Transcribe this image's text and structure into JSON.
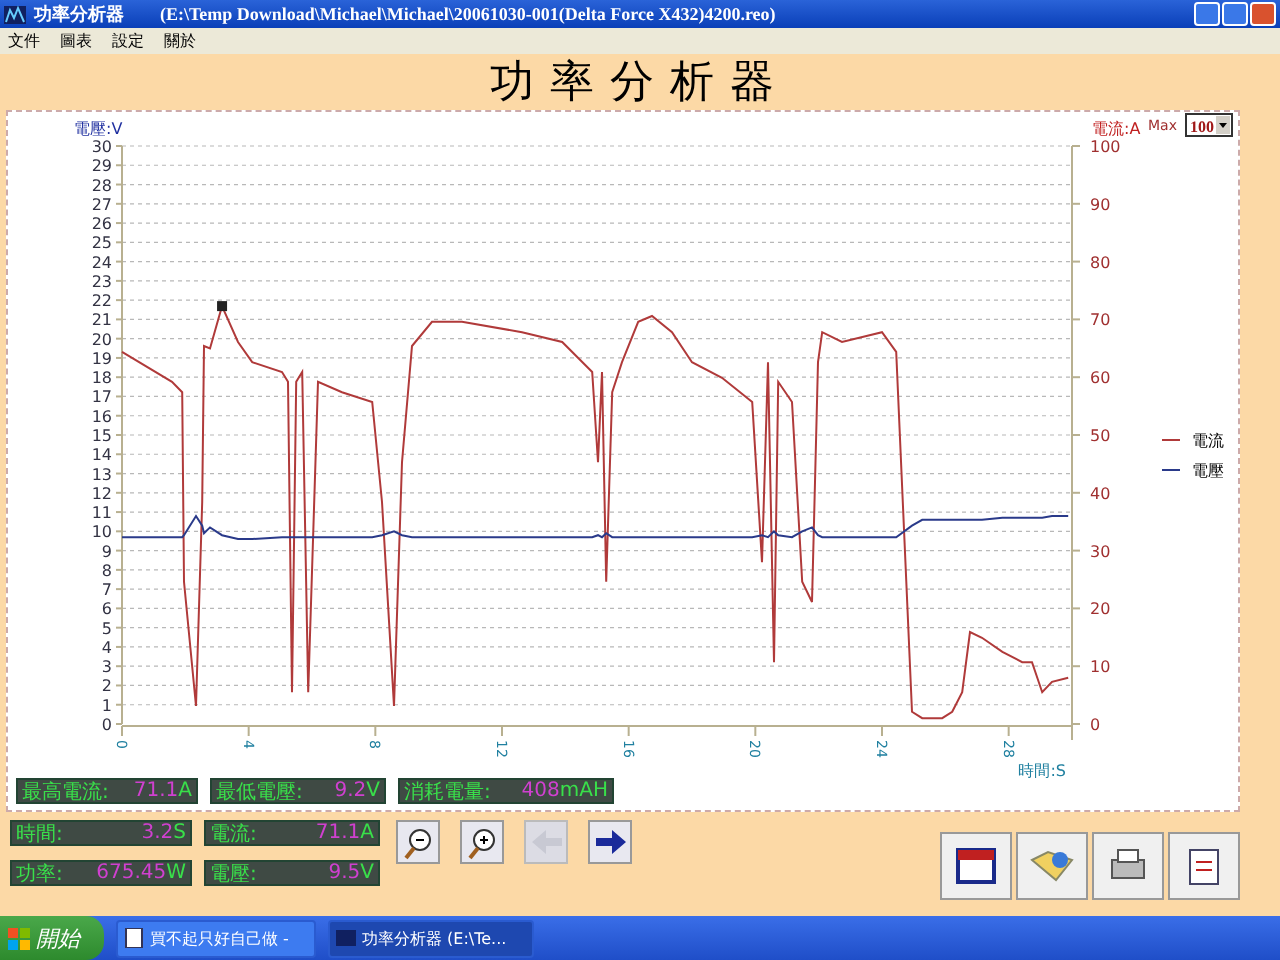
{
  "window": {
    "title": "功率分析器",
    "path": "(E:\\Temp Download\\Michael\\Michael\\20061030-001(Delta Force X432)4200.reo)"
  },
  "menu": [
    "文件",
    "圖表",
    "設定",
    "關於"
  ],
  "heading": "功率分析器",
  "max_select": {
    "label": "Max",
    "value": "100"
  },
  "chart": {
    "chart_data": {
      "type": "line",
      "grid": true,
      "legend": true,
      "xlabel": "時間:S",
      "ylabel": "電壓:V",
      "y2label": "電流:A",
      "xlim": [
        0,
        30
      ],
      "ylim": [
        0,
        30
      ],
      "y2lim": [
        0,
        100
      ],
      "xticks": [
        0,
        4,
        8,
        12,
        16,
        20,
        24,
        28
      ],
      "yticks": [
        0,
        1,
        2,
        3,
        4,
        5,
        6,
        7,
        8,
        9,
        10,
        11,
        12,
        13,
        14,
        15,
        16,
        17,
        18,
        19,
        20,
        21,
        22,
        23,
        24,
        25,
        26,
        27,
        28,
        29,
        30
      ],
      "y2ticks": [
        0,
        10,
        20,
        30,
        40,
        50,
        60,
        70,
        80,
        90,
        100
      ],
      "x": [
        0,
        1.58,
        1.9,
        1.96,
        2.34,
        2.53,
        2.59,
        2.78,
        3.16,
        3.66,
        4.11,
        5.05,
        5.24,
        5.37,
        5.5,
        5.69,
        5.88,
        6.19,
        6.95,
        7.9,
        8.21,
        8.59,
        8.84,
        9.16,
        9.79,
        10.74,
        12.63,
        13.9,
        14.85,
        15.03,
        15.16,
        15.29,
        15.48,
        15.79,
        16.3,
        16.74,
        17.37,
        18.0,
        18.95,
        19.9,
        20.21,
        20.4,
        20.59,
        20.72,
        21.16,
        21.48,
        21.79,
        21.98,
        22.11,
        22.74,
        24.0,
        24.45,
        24.95,
        25.27,
        25.9,
        26.22,
        26.53,
        26.78,
        27.16,
        27.8,
        28.43,
        28.74,
        29.06,
        29.37,
        29.88
      ],
      "series": [
        {
          "name": "電流",
          "color": "#b03a3a",
          "axis": "y2",
          "values": [
            64.4,
            59.2,
            57.4,
            24.6,
            3.1,
            38.4,
            65.4,
            65.0,
            72.3,
            66.1,
            62.6,
            60.9,
            59.2,
            5.5,
            59.2,
            60.9,
            5.5,
            59.2,
            57.4,
            55.7,
            38.4,
            3.1,
            45.3,
            65.4,
            69.6,
            69.6,
            67.8,
            66.1,
            60.9,
            45.3,
            60.9,
            24.6,
            57.4,
            62.6,
            69.6,
            70.6,
            67.8,
            62.6,
            59.9,
            55.7,
            28.0,
            62.6,
            10.7,
            59.2,
            55.7,
            24.6,
            21.1,
            62.6,
            67.8,
            66.1,
            67.8,
            64.4,
            2.1,
            1.0,
            1.0,
            2.1,
            5.5,
            15.9,
            14.9,
            12.5,
            10.7,
            10.7,
            5.5,
            7.3,
            8.0
          ]
        },
        {
          "name": "電壓",
          "color": "#2a3a8a",
          "values": [
            9.7,
            9.7,
            9.7,
            9.8,
            10.8,
            10.3,
            9.9,
            10.2,
            9.8,
            9.6,
            9.6,
            9.7,
            9.7,
            9.7,
            9.7,
            9.7,
            9.7,
            9.7,
            9.7,
            9.7,
            9.8,
            10.0,
            9.8,
            9.7,
            9.7,
            9.7,
            9.7,
            9.7,
            9.7,
            9.8,
            9.7,
            9.9,
            9.7,
            9.7,
            9.7,
            9.7,
            9.7,
            9.7,
            9.7,
            9.7,
            9.8,
            9.7,
            10.0,
            9.8,
            9.7,
            10.0,
            10.2,
            9.8,
            9.7,
            9.7,
            9.7,
            9.7,
            10.3,
            10.6,
            10.6,
            10.6,
            10.6,
            10.6,
            10.6,
            10.7,
            10.7,
            10.7,
            10.7,
            10.8,
            10.8
          ]
        }
      ]
    }
  },
  "stats": [
    [
      {
        "label": "最高電流:",
        "value": "71.1",
        "unit": "A"
      },
      {
        "label": "最低電壓:",
        "value": "9.2",
        "unit": "V"
      },
      {
        "label": "消耗電量:",
        "value": "408",
        "unit": "mAH"
      }
    ],
    [
      {
        "label": "時間:",
        "value": "3.2",
        "unit": "S"
      },
      {
        "label": "電流:",
        "value": "71.1",
        "unit": "A"
      }
    ],
    [
      {
        "label": "功率:",
        "value": "675.45",
        "unit": "W"
      },
      {
        "label": "電壓:",
        "value": "9.5",
        "unit": "V"
      }
    ]
  ],
  "nav_buttons": [
    {
      "kind": "zoom-out",
      "disabled": false
    },
    {
      "kind": "zoom-in",
      "disabled": false
    },
    {
      "kind": "back",
      "disabled": true
    },
    {
      "kind": "forward",
      "disabled": false
    }
  ],
  "tool_buttons": [
    {
      "kind": "chart"
    },
    {
      "kind": "open"
    },
    {
      "kind": "print"
    },
    {
      "kind": "export"
    }
  ],
  "taskbar": {
    "start": "開始",
    "tasks": [
      {
        "label": "買不起只好自己做 -",
        "selected": false
      },
      {
        "label": "功率分析器   (E:\\Te...",
        "selected": true
      }
    ]
  }
}
